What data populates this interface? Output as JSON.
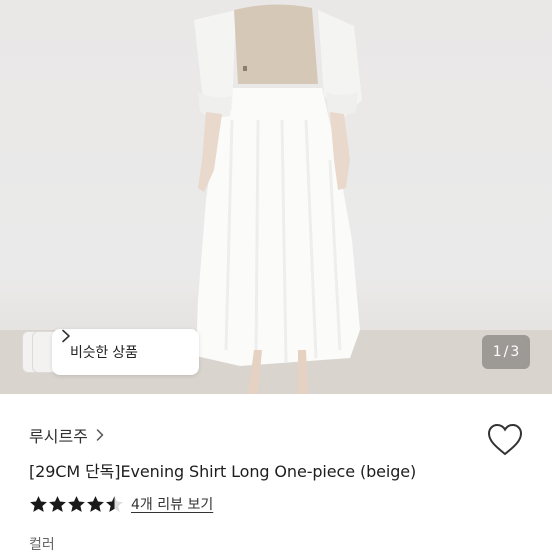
{
  "image": {
    "similar_products_label": "비슷한 상품",
    "page_current": "1",
    "page_separator": "/",
    "page_total": "3"
  },
  "product": {
    "brand": "루시르주",
    "title": "[29CM 단독]Evening Shirt Long One-piece (beige)",
    "rating": 4.5,
    "rating_max": 5,
    "review_link": "4개 리뷰 보기",
    "option_label": "컬러"
  },
  "colors": {
    "star": "#1a1a1a",
    "heart_outline": "#333333",
    "indicator_bg": "#7a7876"
  },
  "icons": {
    "similar_chevron": "chevron-right-icon",
    "brand_chevron": "chevron-right-icon",
    "wish": "heart-outline-icon",
    "rating": "star-icon"
  }
}
